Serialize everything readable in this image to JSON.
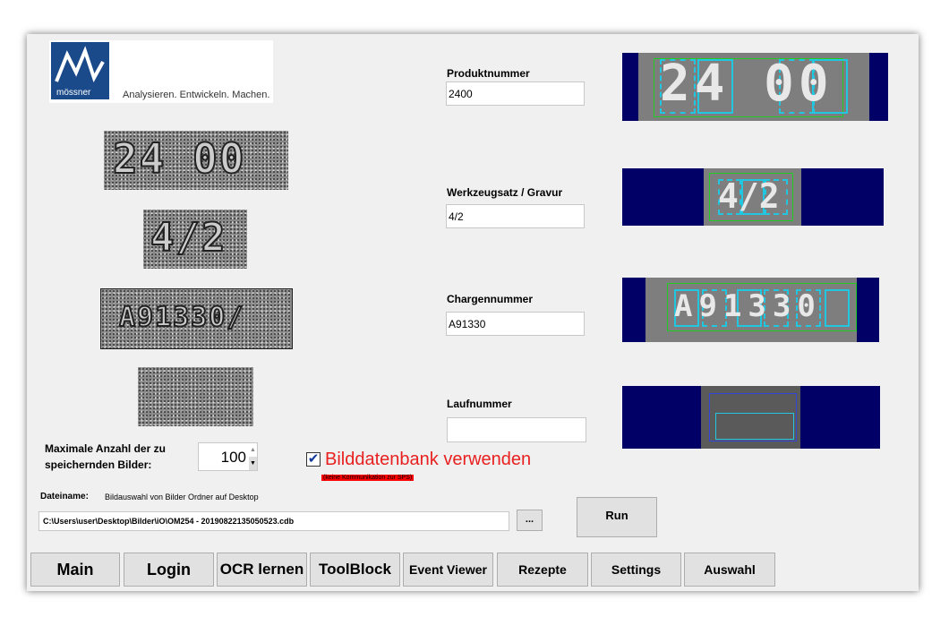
{
  "logo": {
    "brand": "mössner",
    "tagline": "Analysieren. Entwickeln. Machen."
  },
  "preview_images": [
    {
      "text": "24 00"
    },
    {
      "text": "4/2"
    },
    {
      "text": "A91330/"
    },
    {
      "text": ""
    }
  ],
  "fields": [
    {
      "label": "Produktnummer",
      "value": "2400"
    },
    {
      "label": "Werkzeugsatz / Gravur",
      "value": "4/2"
    },
    {
      "label": "Chargennummer",
      "value": "A91330"
    },
    {
      "label": "Laufnummer",
      "value": ""
    }
  ],
  "ocr_results": [
    {
      "text": "24 00"
    },
    {
      "text": "4/2"
    },
    {
      "text": "A91330"
    },
    {
      "text": ""
    }
  ],
  "max_images": {
    "label_line1": "Maximale Anzahl der zu",
    "label_line2": "speichernden Bilder:",
    "value": "100"
  },
  "database": {
    "checked": true,
    "label": "Bilddatenbank verwenden",
    "warning": "(keine Kommunikation zur SPS)",
    "color": "#e82020"
  },
  "file": {
    "label": "Dateiname:",
    "hint": "Bildauswahl von Bilder Ordner auf Desktop",
    "path": "C:\\Users\\user\\Desktop\\Bilder\\iO\\OM254 - 20190822135050523.cdb",
    "browse_label": "...",
    "run_label": "Run"
  },
  "nav": [
    "Main",
    "Login",
    "OCR lernen",
    "ToolBlock",
    "Event Viewer",
    "Rezepte",
    "Settings",
    "Auswahl"
  ],
  "colors": {
    "ocr_bg": "#000066",
    "window_bg": "#f0f0f0",
    "box_cyan": "#21c6e0",
    "box_green": "#22cc22"
  }
}
